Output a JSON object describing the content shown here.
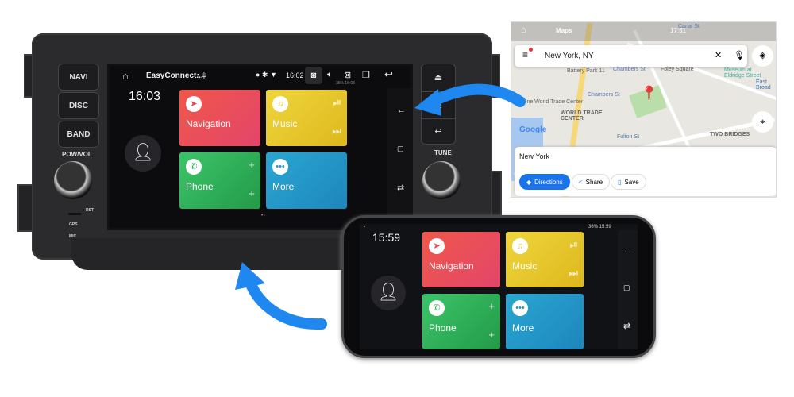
{
  "head_unit": {
    "buttons": [
      "NAVI",
      "DISC",
      "BAND"
    ],
    "labels": {
      "pow_vol": "POW/VOL",
      "tune": "TUNE",
      "rst": "RST",
      "gps": "GPS",
      "mic": "MIC"
    },
    "status_bar": {
      "app_title": "EasyConnect...",
      "time": "16:02",
      "sub_status": "35% 16:03"
    },
    "clock": "16:03",
    "tiles": [
      {
        "label": "Navigation",
        "color": "#e8474f"
      },
      {
        "label": "Music",
        "color": "#e6c72a"
      },
      {
        "label": "Phone",
        "color": "#2fae57"
      },
      {
        "label": "More",
        "color": "#2596c8"
      }
    ]
  },
  "map": {
    "status": {
      "app": "Maps",
      "time": "17:51"
    },
    "search_value": "New York, NY",
    "place_labels": [
      "Chambers St",
      "Foley Square",
      "Museum at Eldridge Street",
      "East Broad",
      "One World Trade Center",
      "WORLD TRADE CENTER",
      "Fulton St",
      "TWO BRIDGES",
      "Battery Park 11",
      "Canal St"
    ],
    "logo": "Google",
    "result_title": "New York",
    "actions": {
      "directions": "Directions",
      "share": "Share",
      "save": "Save"
    }
  },
  "phone": {
    "status": "36% 15:59",
    "clock": "15:59",
    "tiles": [
      {
        "label": "Navigation"
      },
      {
        "label": "Music"
      },
      {
        "label": "Phone"
      },
      {
        "label": "More"
      }
    ]
  },
  "arrow_color": "#1e88f0"
}
